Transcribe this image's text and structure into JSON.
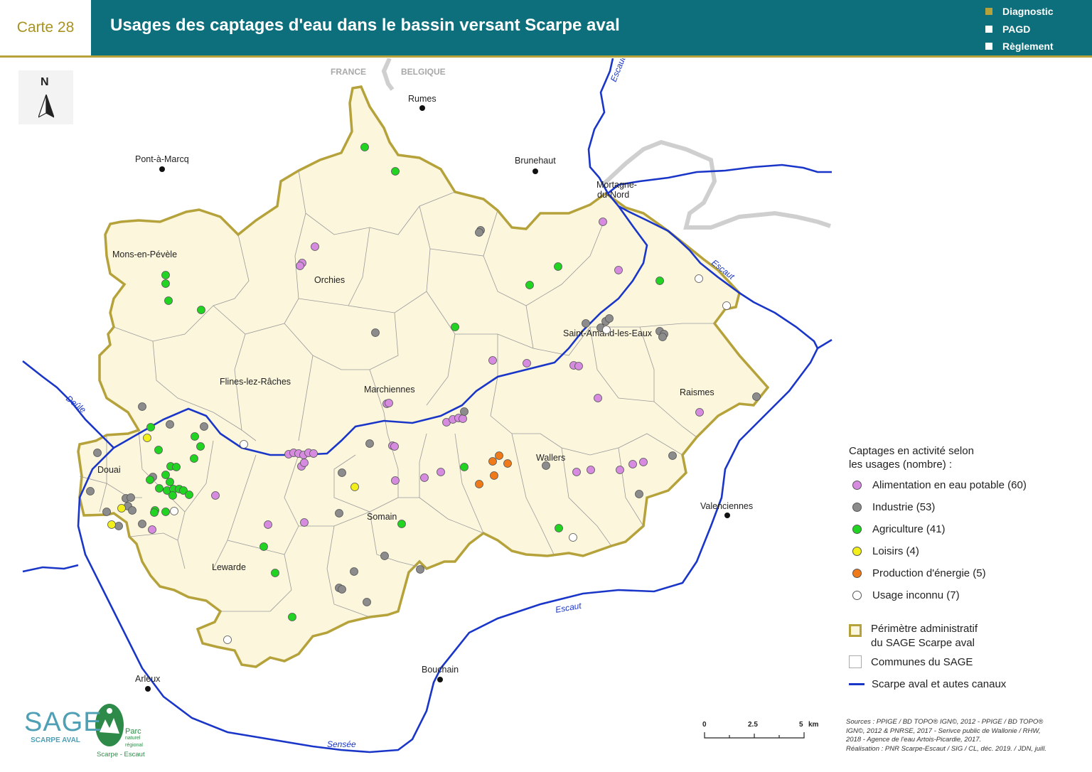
{
  "header": {
    "carte_label": "Carte 28",
    "title": "Usages des captages d'eau dans le bassin versant Scarpe aval",
    "phases": [
      {
        "label": "Diagnostic",
        "color": "#b5a23a"
      },
      {
        "label": "PAGD",
        "color": "#ffffff"
      },
      {
        "label": "Règlement",
        "color": "#ffffff"
      }
    ]
  },
  "compass": {
    "label": "N"
  },
  "countries": {
    "france": "FRANCE",
    "belgique": "BELGIQUE"
  },
  "towns": {
    "rumes": "Rumes",
    "pont_a_marcq": "Pont-à-Marcq",
    "brunehaut": "Brunehaut",
    "mortagne": "Mortagne-",
    "mortagne2": "du-Nord",
    "mons_en_pevele": "Mons-en-Pévèle",
    "orchies": "Orchies",
    "saint_amand": "Saint-Amand-les-Eaux",
    "flines": "Flines-lez-Râches",
    "marchiennes": "Marchiennes",
    "raismes": "Raismes",
    "douai": "Douai",
    "wallers": "Wallers",
    "somain": "Somain",
    "valenciennes": "Valenciennes",
    "lewarde": "Lewarde",
    "bouchain": "Bouchain",
    "arleux": "Arleux"
  },
  "rivers": {
    "escaut": "Escaut",
    "deule": "Deûle",
    "sensee": "Sensée"
  },
  "legend": {
    "title_line1": "Captages en activité selon",
    "title_line2": "les usages (nombre) :",
    "items": [
      {
        "label": "Alimentation en eau potable (60)",
        "color": "#d68be0"
      },
      {
        "label": "Industrie (53)",
        "color": "#8c8c8c"
      },
      {
        "label": "Agriculture (41)",
        "color": "#22d422"
      },
      {
        "label": "Loisirs (4)",
        "color": "#f2ef1a"
      },
      {
        "label": "Production d'énergie (5)",
        "color": "#f07a1a"
      },
      {
        "label": "Usage inconnu (7)",
        "color": "#ffffff"
      }
    ],
    "perimetre_line1": "Périmètre administratif",
    "perimetre_line2": "du SAGE Scarpe aval",
    "communes": "Communes du SAGE",
    "canaux": "Scarpe aval et autes canaux"
  },
  "scale": {
    "t0": "0",
    "t1": "2.5",
    "t2": "5",
    "unit": "km"
  },
  "sources": {
    "line1": "Sources : PPIGE / BD TOPO® IGN©, 2012 - PPIGE / BD TOPO®",
    "line2": "IGN©, 2012 & PNRSE, 2017 - Serivce public de Wallonie / RHW,",
    "line3": "2018 - Agence de l'eau Artois-Picardie, 2017.",
    "line4": "Réalisation : PNR Scarpe-Escaut / SIG / CL, déc. 2019. / JDN, juill."
  },
  "logos": {
    "sage": "SAGE",
    "sage_sub": "SCARPE AVAL",
    "parc_line1": "Parc",
    "parc_line2": "naturel",
    "parc_line3": "régional",
    "parc_bottom": "Scarpe - Escaut"
  },
  "colors": {
    "header_bg": "#0e6f7c",
    "accent": "#b5a23a",
    "territory": "#fbf6dc",
    "border": "#b5a23a",
    "water": "#1a36c8"
  }
}
